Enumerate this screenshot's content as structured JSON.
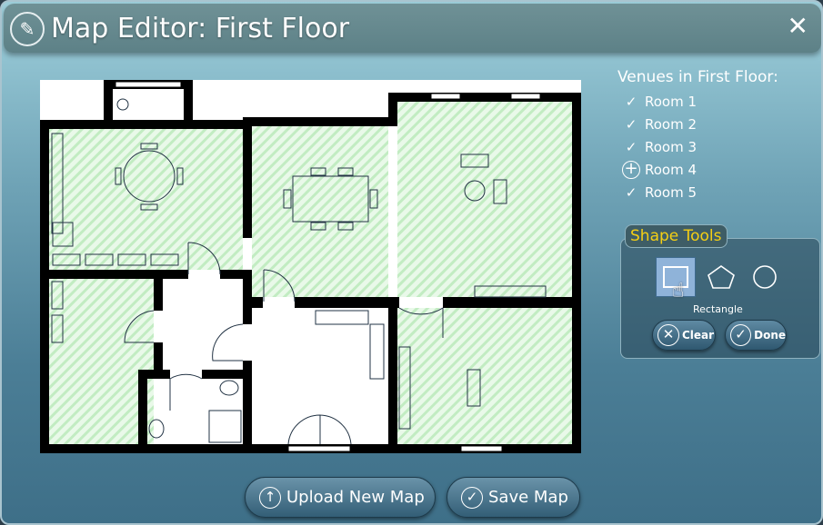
{
  "window": {
    "title": "Map Editor: First Floor",
    "close_icon": "close-icon",
    "title_icon": "pencil-icon"
  },
  "venues": {
    "heading": "Venues in First Floor:",
    "items": [
      {
        "label": "Room 1",
        "status": "check"
      },
      {
        "label": "Room 2",
        "status": "check"
      },
      {
        "label": "Room 3",
        "status": "check"
      },
      {
        "label": "Room 4",
        "status": "add"
      },
      {
        "label": "Room 5",
        "status": "check"
      }
    ]
  },
  "shape_tools": {
    "title": "Shape Tools",
    "shapes": [
      "rectangle",
      "pentagon",
      "circle"
    ],
    "selected": "rectangle",
    "selected_label": "Rectangle",
    "clear_label": "Clear",
    "done_label": "Done"
  },
  "actions": {
    "upload_label": "Upload New Map",
    "save_label": "Save Map"
  },
  "colors": {
    "room_fill": "#c9efc9",
    "title_accent": "#f5cf14"
  }
}
